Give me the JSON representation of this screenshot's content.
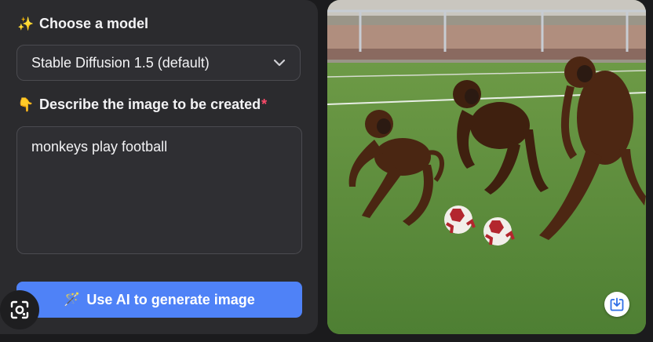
{
  "model_section": {
    "emoji": "✨",
    "label": "Choose a model",
    "selected": "Stable Diffusion 1.5 (default)"
  },
  "prompt_section": {
    "emoji": "👇",
    "label": "Describe the image to be created",
    "required_mark": "*",
    "value": "monkeys play football"
  },
  "generate_button": {
    "emoji": "🪄",
    "label": "Use AI to generate image"
  },
  "colors": {
    "accent": "#4f82f7",
    "panel": "#2b2b2e",
    "required": "#ff4a6a"
  },
  "icons": [
    "sparkles-icon",
    "chevron-down-icon",
    "pointing-down-icon",
    "magic-wand-icon",
    "lens-icon",
    "download-icon"
  ]
}
